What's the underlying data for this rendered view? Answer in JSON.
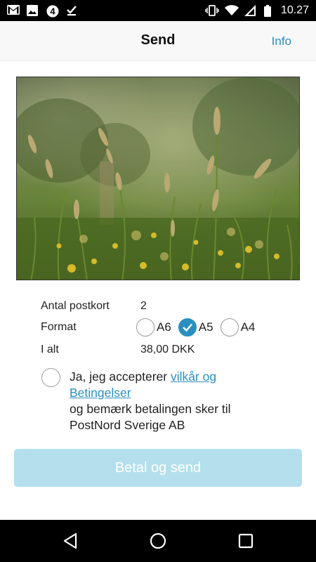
{
  "status_bar": {
    "time": "10.27",
    "left_icons": [
      "gmail-icon",
      "image-icon",
      "channel4-icon",
      "download-done-icon"
    ],
    "right_icons": [
      "vibrate-icon",
      "wifi-icon",
      "signal-icon",
      "battery-icon"
    ],
    "channel_glyph": "4"
  },
  "app_bar": {
    "title": "Send",
    "info_label": "Info"
  },
  "photo": {
    "description_icon": "meadow-photo"
  },
  "details": {
    "count_label": "Antal postkort",
    "count_value": "2",
    "format_label": "Format",
    "format_options": [
      {
        "label": "A6",
        "selected": false
      },
      {
        "label": "A5",
        "selected": true
      },
      {
        "label": "A4",
        "selected": false
      }
    ],
    "total_label": "I alt",
    "total_value": "38,00 DKK"
  },
  "terms": {
    "prefix": "Ja, jeg accepterer ",
    "link_text": "vilkår og Betingelser",
    "suffix": "og bemærk betalingen sker til PostNord Sverige AB",
    "accepted": false
  },
  "pay_button": {
    "label": "Betal og send",
    "enabled": false
  },
  "nav_bar": {
    "icons": [
      "back-icon",
      "home-icon",
      "recents-icon"
    ]
  },
  "colors": {
    "accent": "#2a8fc0",
    "button_disabled": "#b3e0ec",
    "app_bar_bg": "#f8f8f8",
    "system_bars": "#000000"
  }
}
